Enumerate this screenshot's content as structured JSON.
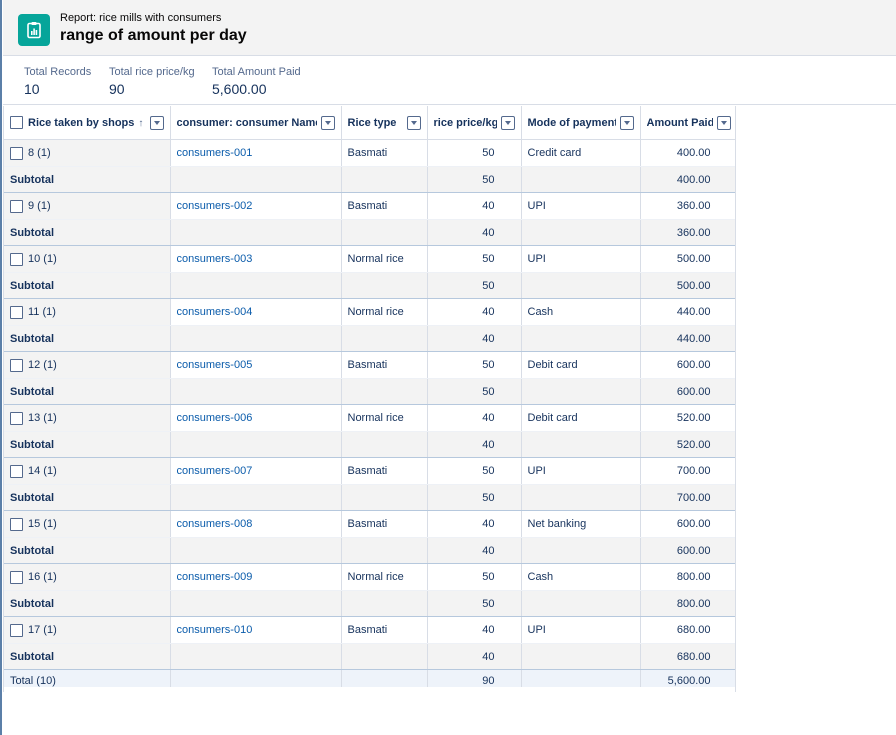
{
  "header": {
    "subtitle": "Report: rice mills with consumers",
    "title": "range of amount per day",
    "icon": "report-icon"
  },
  "summary": {
    "metrics": [
      {
        "label": "Total Records",
        "value": "10"
      },
      {
        "label": "Total rice price/kg",
        "value": "90"
      },
      {
        "label": "Total Amount Paid",
        "value": "5,600.00"
      }
    ]
  },
  "table": {
    "columns": [
      {
        "label": "Rice taken by shops",
        "sorted": "ascending"
      },
      {
        "label": "consumer: consumer Name"
      },
      {
        "label": "Rice type"
      },
      {
        "label": "rice price/kg"
      },
      {
        "label": "Mode of payment"
      },
      {
        "label": "Amount Paid"
      }
    ],
    "groups": [
      {
        "group": "8 (1)",
        "consumer": "consumers-001",
        "rice_type": "Basmati",
        "price": "50",
        "payment": "Credit card",
        "amount": "400.00",
        "subtotal_label": "Subtotal",
        "subtotal_price": "50",
        "subtotal_amount": "400.00"
      },
      {
        "group": "9 (1)",
        "consumer": "consumers-002",
        "rice_type": "Basmati",
        "price": "40",
        "payment": "UPI",
        "amount": "360.00",
        "subtotal_label": "Subtotal",
        "subtotal_price": "40",
        "subtotal_amount": "360.00"
      },
      {
        "group": "10 (1)",
        "consumer": "consumers-003",
        "rice_type": "Normal rice",
        "price": "50",
        "payment": "UPI",
        "amount": "500.00",
        "subtotal_label": "Subtotal",
        "subtotal_price": "50",
        "subtotal_amount": "500.00"
      },
      {
        "group": "11 (1)",
        "consumer": "consumers-004",
        "rice_type": "Normal rice",
        "price": "40",
        "payment": "Cash",
        "amount": "440.00",
        "subtotal_label": "Subtotal",
        "subtotal_price": "40",
        "subtotal_amount": "440.00"
      },
      {
        "group": "12 (1)",
        "consumer": "consumers-005",
        "rice_type": "Basmati",
        "price": "50",
        "payment": "Debit card",
        "amount": "600.00",
        "subtotal_label": "Subtotal",
        "subtotal_price": "50",
        "subtotal_amount": "600.00"
      },
      {
        "group": "13 (1)",
        "consumer": "consumers-006",
        "rice_type": "Normal rice",
        "price": "40",
        "payment": "Debit card",
        "amount": "520.00",
        "subtotal_label": "Subtotal",
        "subtotal_price": "40",
        "subtotal_amount": "520.00"
      },
      {
        "group": "14 (1)",
        "consumer": "consumers-007",
        "rice_type": "Basmati",
        "price": "50",
        "payment": "UPI",
        "amount": "700.00",
        "subtotal_label": "Subtotal",
        "subtotal_price": "50",
        "subtotal_amount": "700.00"
      },
      {
        "group": "15 (1)",
        "consumer": "consumers-008",
        "rice_type": "Basmati",
        "price": "40",
        "payment": "Net banking",
        "amount": "600.00",
        "subtotal_label": "Subtotal",
        "subtotal_price": "40",
        "subtotal_amount": "600.00"
      },
      {
        "group": "16 (1)",
        "consumer": "consumers-009",
        "rice_type": "Normal rice",
        "price": "50",
        "payment": "Cash",
        "amount": "800.00",
        "subtotal_label": "Subtotal",
        "subtotal_price": "50",
        "subtotal_amount": "800.00"
      },
      {
        "group": "17 (1)",
        "consumer": "consumers-010",
        "rice_type": "Basmati",
        "price": "40",
        "payment": "UPI",
        "amount": "680.00",
        "subtotal_label": "Subtotal",
        "subtotal_price": "40",
        "subtotal_amount": "680.00"
      }
    ],
    "total": {
      "label": "Total (10)",
      "price": "90",
      "amount": "5,600.00"
    }
  },
  "colors": {
    "icon_bg": "#06a59a",
    "link": "#0b5cab",
    "header_bg": "#f3f3f3"
  }
}
